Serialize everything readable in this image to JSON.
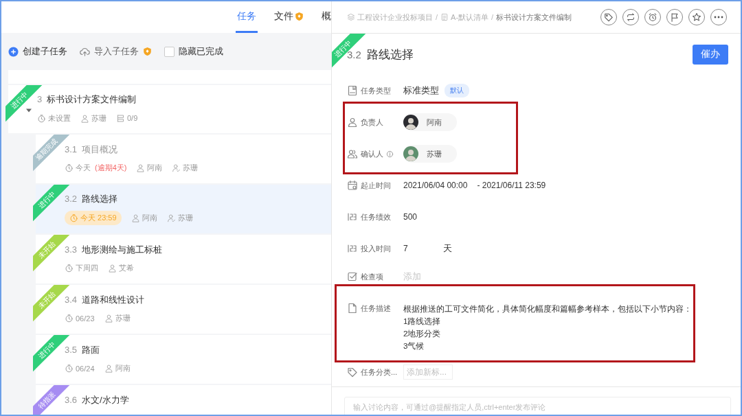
{
  "left_panel": {
    "tabs": [
      {
        "label": "任务",
        "selected": true,
        "premium": false
      },
      {
        "label": "文件",
        "selected": false,
        "premium": true
      },
      {
        "label": "概",
        "selected": false,
        "premium": false
      }
    ],
    "toolbar": {
      "create_label": "创建子任务",
      "import": {
        "label": "导入子任务",
        "premium": true
      },
      "hide_completed": {
        "label": "隐藏已完成",
        "checked": false
      }
    },
    "parent_task": {
      "status": "进行中",
      "color": "#2fcf7a",
      "number": "3",
      "title": "标书设计方案文件编制",
      "expanded": true,
      "selected": false,
      "done": false,
      "meta": [
        {
          "kind": "due",
          "text": "未设置"
        },
        {
          "kind": "assignee",
          "text": "苏珊"
        },
        {
          "kind": "subtasks",
          "text": "0/9"
        }
      ]
    },
    "subtasks": [
      {
        "status": "逾期完成",
        "color": "#a9c2cb",
        "number": "3.1",
        "title": "项目概况",
        "selected": false,
        "done": true,
        "meta": [
          {
            "kind": "due",
            "text": "今天"
          },
          {
            "kind": "overdue",
            "text": "(逾期4天)"
          },
          {
            "kind": "assignee",
            "text": "阿南"
          },
          {
            "kind": "confirmer",
            "text": "苏珊"
          }
        ]
      },
      {
        "status": "进行中",
        "color": "#2fcf7a",
        "number": "3.2",
        "title": "路线选择",
        "selected": true,
        "done": false,
        "meta": [
          {
            "kind": "due_soon",
            "text": "今天 23:59"
          },
          {
            "kind": "assignee",
            "text": "阿南"
          },
          {
            "kind": "confirmer",
            "text": "苏珊"
          }
        ]
      },
      {
        "status": "未开始",
        "color": "#a6d84a",
        "number": "3.3",
        "title": "地形测绘与施工标桩",
        "selected": false,
        "done": false,
        "meta": [
          {
            "kind": "due",
            "text": "下周四"
          },
          {
            "kind": "assignee",
            "text": "艾希"
          }
        ]
      },
      {
        "status": "未开始",
        "color": "#a6d84a",
        "number": "3.4",
        "title": "道路和线性设计",
        "selected": false,
        "done": false,
        "meta": [
          {
            "kind": "due",
            "text": "06/23"
          },
          {
            "kind": "assignee",
            "text": "苏珊"
          }
        ]
      },
      {
        "status": "进行中",
        "color": "#2fcf7a",
        "number": "3.5",
        "title": "路面",
        "selected": false,
        "done": false,
        "meta": [
          {
            "kind": "due",
            "text": "06/24"
          },
          {
            "kind": "assignee",
            "text": "阿南"
          }
        ]
      },
      {
        "status": "待指派",
        "color": "#a68cf2",
        "number": "3.6",
        "title": "水文/水力学",
        "selected": false,
        "done": false
      }
    ]
  },
  "detail": {
    "breadcrumb": [
      {
        "kind": "project",
        "text": "工程设计企业投标项目"
      },
      {
        "kind": "list",
        "text": "A-默认清单"
      },
      {
        "kind": "task",
        "text": "标书设计方案文件编制"
      }
    ],
    "separator": "/",
    "status": "进行中",
    "color": "#2fcf7a",
    "number": "3.2",
    "title": "路线选择",
    "urge_button": "催办",
    "field_groups": [
      {
        "highlighted": false,
        "fields": [
          {
            "kind": "type",
            "label": "任务类型",
            "value": "标准类型",
            "tag": "默认"
          }
        ]
      },
      {
        "highlighted": true,
        "fields": [
          {
            "kind": "person",
            "label": "负责人",
            "value": "阿南"
          },
          {
            "kind": "people",
            "label": "确认人",
            "value": "苏珊"
          }
        ]
      },
      {
        "highlighted": false,
        "fields": [
          {
            "kind": "date",
            "label": "起止时间",
            "value": "2021/06/04 00:00",
            "value_end": "- 2021/06/11 23:59"
          },
          {
            "kind": "number",
            "label": "任务绩效",
            "value": "500"
          },
          {
            "kind": "duration",
            "label": "投入时间",
            "value": "7",
            "unit": "天"
          },
          {
            "kind": "checklist",
            "label": "检查项",
            "placeholder": "添加"
          }
        ]
      },
      {
        "highlighted": true,
        "fields": [
          {
            "kind": "description",
            "label": "任务描述",
            "lines": [
              "根据推送的工可文件简化，具体简化幅度和篇幅参考样本，包括以下小节内容：",
              "1路线选择",
              "2地形分类",
              "3气候"
            ]
          }
        ]
      },
      {
        "highlighted": false,
        "fields": [
          {
            "kind": "tags",
            "label": "任务分类...",
            "placeholder": "添加新标..."
          }
        ]
      }
    ],
    "comment": {
      "placeholder": "输入讨论内容，可通过@提醒指定人员,ctrl+enter发布评论"
    }
  }
}
